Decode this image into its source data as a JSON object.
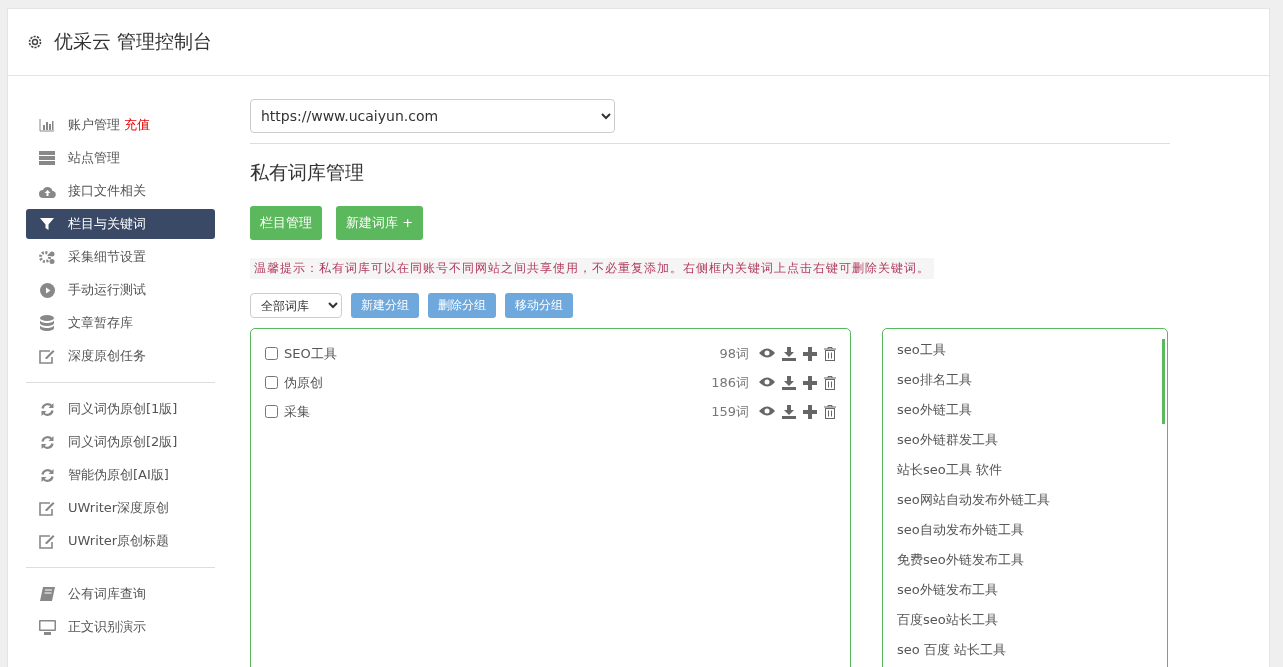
{
  "header": {
    "title": "优采云 管理控制台"
  },
  "sidebar": {
    "groups": [
      [
        {
          "label": "账户管理",
          "badge": "充值",
          "selected": false
        },
        {
          "label": "站点管理",
          "selected": false
        },
        {
          "label": "接口文件相关",
          "selected": false
        },
        {
          "label": "栏目与关键词",
          "selected": true
        },
        {
          "label": "采集细节设置",
          "selected": false
        },
        {
          "label": "手动运行测试",
          "selected": false
        },
        {
          "label": "文章暂存库",
          "selected": false
        },
        {
          "label": "深度原创任务",
          "selected": false
        }
      ],
      [
        {
          "label": "同义词伪原创[1版]",
          "selected": false
        },
        {
          "label": "同义词伪原创[2版]",
          "selected": false
        },
        {
          "label": "智能伪原创[AI版]",
          "selected": false
        },
        {
          "label": "UWriter深度原创",
          "selected": false
        },
        {
          "label": "UWriter原创标题",
          "selected": false
        }
      ],
      [
        {
          "label": "公有词库查询",
          "selected": false
        },
        {
          "label": "正文识别演示",
          "selected": false
        }
      ]
    ]
  },
  "site_select": {
    "value": "https://www.ucaiyun.com"
  },
  "section_title": "私有词库管理",
  "action_buttons": [
    "栏目管理",
    "新建词库 +"
  ],
  "tip": "温馨提示：私有词库可以在同账号不同网站之间共享使用，不必重复添加。右侧框内关键词上点击右键可删除关键词。",
  "group_filter": {
    "value": "全部词库"
  },
  "group_buttons": [
    "新建分组",
    "删除分组",
    "移动分组"
  ],
  "libraries": [
    {
      "name": "SEO工具",
      "count": "98词",
      "checked": false
    },
    {
      "name": "伪原创",
      "count": "186词",
      "checked": false
    },
    {
      "name": "采集",
      "count": "159词",
      "checked": false
    }
  ],
  "keywords": [
    "seo工具",
    "seo排名工具",
    "seo外链工具",
    "seo外链群发工具",
    "站长seo工具 软件",
    "seo网站自动发布外链工具",
    "seo自动发布外链工具",
    "免费seo外链发布工具",
    "seo外链发布工具",
    "百度seo站长工具",
    "seo 百度 站长工具"
  ]
}
